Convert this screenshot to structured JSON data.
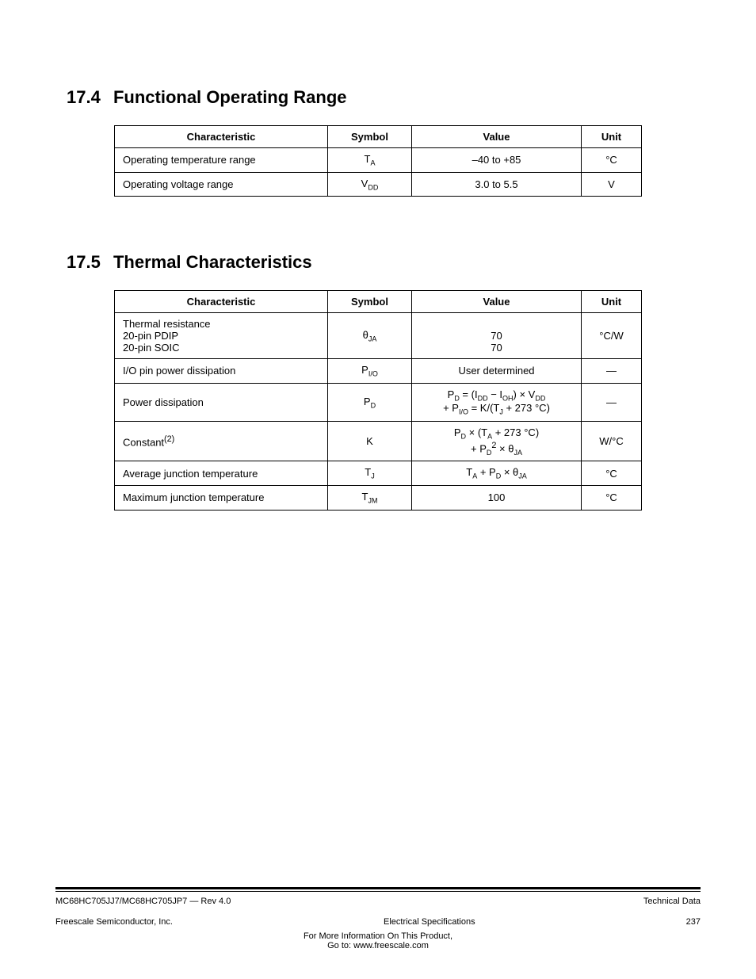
{
  "section1": {
    "num": "17.4",
    "title": "Functional Operating Range",
    "table": {
      "headers": [
        "Characteristic",
        "Symbol",
        "Value",
        "Unit"
      ],
      "widths": [
        248,
        85,
        193,
        55
      ],
      "rows": [
        {
          "characteristic": "Operating temperature range",
          "symbol": "T<sub>A</sub>",
          "value": "–40 to +85",
          "unit": "°C"
        },
        {
          "characteristic": "Operating voltage range",
          "symbol": "V<sub>DD</sub>",
          "value": "3.0 to 5.5",
          "unit": "V"
        }
      ]
    }
  },
  "section2": {
    "num": "17.5",
    "title": "Thermal Characteristics",
    "table": {
      "headers": [
        "Characteristic",
        "Symbol",
        "Value",
        "Unit"
      ],
      "widths": [
        248,
        85,
        193,
        55
      ],
      "rows": [
        {
          "characteristic": "Thermal resistance<br>20-pin PDIP<br>20-pin SOIC",
          "symbol": "θ<sub>JA</sub>",
          "value": "<br>70<br>70",
          "unit": "°C/W",
          "height": 54
        },
        {
          "characteristic": "I/O pin power dissipation",
          "symbol": "P<sub>I/O</sub>",
          "value": "User determined",
          "unit": "—"
        },
        {
          "characteristic": "Power dissipation",
          "symbol": "P<sub>D</sub>",
          "value": "P<sub>D</sub> = (I<sub>DD</sub> − I<sub>OH</sub>) × V<sub>DD</sub><br>+ P<sub>I/O</sub> = K/(T<sub>J</sub> + 273 °C)",
          "unit": "—"
        },
        {
          "characteristic": "Constant<sup>(2)</sup>",
          "symbol": "K",
          "value": "P<sub>D</sub> × (T<sub>A</sub> + 273 °C)<br>+ P<sub>D</sub><sup>2</sup> × θ<sub>JA</sub>",
          "unit": "W/°C"
        },
        {
          "characteristic": "Average junction temperature",
          "symbol": "T<sub>J</sub>",
          "value": "T<sub>A</sub> + P<sub>D</sub> × θ<sub>JA</sub>",
          "unit": "°C"
        },
        {
          "characteristic": "Maximum junction temperature",
          "symbol": "T<sub>JM</sub>",
          "value": "100",
          "unit": "°C"
        }
      ]
    }
  },
  "footer": {
    "left": "MC68HC705JJ7/MC68HC705JP7 — Rev 4.0",
    "right": "Technical Data",
    "mid": "Electrical Specifications",
    "page": "237",
    "sponsor": "For More Information On This Product,\n  Go to: www.freescale.com"
  }
}
